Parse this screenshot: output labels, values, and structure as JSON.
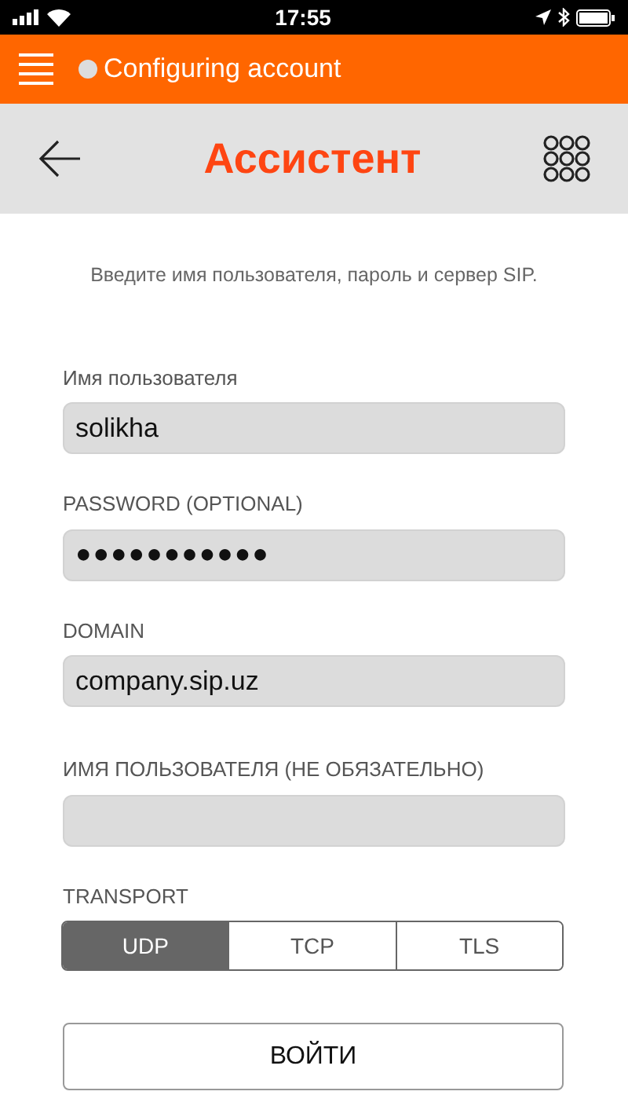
{
  "status_bar": {
    "time": "17:55"
  },
  "app_bar": {
    "status_text": "Configuring account"
  },
  "header": {
    "title": "Ассистент"
  },
  "instructions": "Введите имя пользователя, пароль и сервер SIP.",
  "fields": [
    {
      "label": "Имя пользователя",
      "value": "solikha"
    },
    {
      "label": "PASSWORD (OPTIONAL)",
      "value": "●●●●●●●●●●●"
    },
    {
      "label": "DOMAIN",
      "value": "company.sip.uz"
    },
    {
      "label": "ИМЯ ПОЛЬЗОВАТЕЛЯ (НЕ ОБЯЗАТЕЛЬНО)"
    }
  ],
  "transport": {
    "label": "TRANSPORT",
    "options": [
      {
        "label": "UDP",
        "selected": true
      },
      {
        "label": "TCP",
        "selected": false
      },
      {
        "label": "TLS",
        "selected": false
      }
    ]
  },
  "login_button": "ВОЙТИ"
}
